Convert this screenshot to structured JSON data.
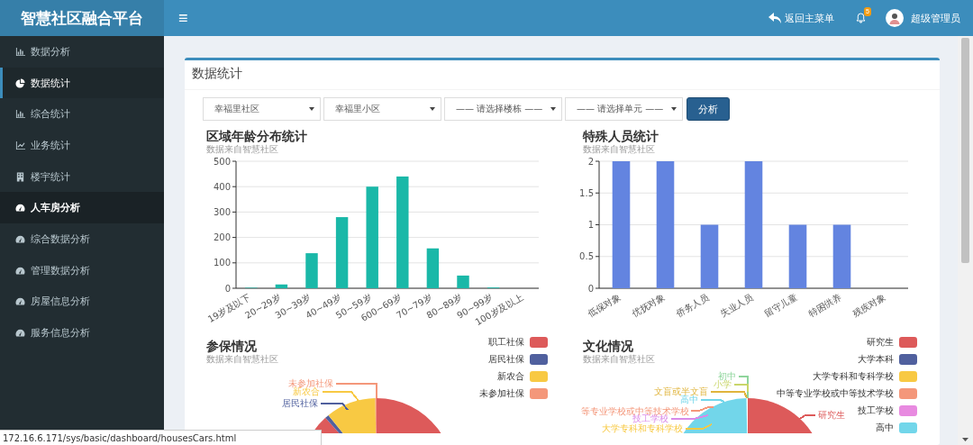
{
  "header": {
    "brand": "智慧社区融合平台",
    "menu_toggle": "≡",
    "back_link": "返回主菜单",
    "notification_count": "5",
    "user_name": "超级管理员"
  },
  "sidebar": {
    "items": [
      {
        "label": "数据分析",
        "selected": false,
        "highlighted": false
      },
      {
        "label": "数据统计",
        "selected": true,
        "highlighted": false
      },
      {
        "label": "综合统计",
        "selected": false,
        "highlighted": false
      },
      {
        "label": "业务统计",
        "selected": false,
        "highlighted": false
      },
      {
        "label": "楼宇统计",
        "selected": false,
        "highlighted": false
      },
      {
        "label": "人车房分析",
        "selected": false,
        "highlighted": true
      },
      {
        "label": "综合数据分析",
        "selected": false,
        "highlighted": false
      },
      {
        "label": "管理数据分析",
        "selected": false,
        "highlighted": false
      },
      {
        "label": "房屋信息分析",
        "selected": false,
        "highlighted": false
      },
      {
        "label": "服务信息分析",
        "selected": false,
        "highlighted": false
      }
    ]
  },
  "card": {
    "title": "数据统计",
    "filters": [
      {
        "value": "幸福里社区"
      },
      {
        "value": "幸福里小区"
      },
      {
        "value": "—— 请选择楼栋 ——"
      },
      {
        "value": "—— 请选择单元 ——"
      }
    ],
    "analyze_button": "分析",
    "bar_charts": [
      {
        "title": "区域年龄分布统计",
        "subtitle": "数据来自智慧社区",
        "chart_data": {
          "type": "bar",
          "categories": [
            "19岁及以下",
            "20~29岁",
            "30~39岁",
            "40~49岁",
            "50~59岁",
            "600~69岁",
            "70~79岁",
            "80~89岁",
            "90~99岁",
            "100岁及以上"
          ],
          "series": [
            {
              "color": "#1ab8a8",
              "values": [
                2,
                15,
                138,
                280,
                400,
                440,
                157,
                50,
                3,
                0
              ]
            }
          ],
          "grid": true,
          "ylim": [
            0,
            500
          ],
          "yticks": [
            0,
            100,
            200,
            300,
            400,
            500
          ]
        }
      },
      {
        "title": "特殊人员统计",
        "subtitle": "数据来自智慧社区",
        "chart_data": {
          "type": "bar",
          "categories": [
            "低保对象",
            "优抚对象",
            "侨务人员",
            "失业人员",
            "留守儿童",
            "特困供养",
            "残疾对象"
          ],
          "series": [
            {
              "color": "#6384e0",
              "values": [
                2,
                2,
                1,
                2,
                1,
                1,
                0
              ]
            }
          ],
          "grid": true,
          "ylim": [
            0,
            2
          ],
          "yticks": [
            0,
            0.5,
            1,
            1.5,
            2
          ]
        }
      }
    ],
    "pie_charts": [
      {
        "title": "参保情况",
        "subtitle": "数据来自智慧社区",
        "legend": [
          {
            "label": "职工社保",
            "color": "#dd5a5a"
          },
          {
            "label": "居民社保",
            "color": "#50609e"
          },
          {
            "label": "新农合",
            "color": "#f8c943"
          },
          {
            "label": "未参加社保",
            "color": "#f4977a"
          }
        ],
        "callouts": [
          {
            "text": "未参加社保",
            "color": "#f4977a"
          },
          {
            "text": "新农合",
            "color": "#f8c943"
          },
          {
            "text": "居民社保",
            "color": "#50609e"
          }
        ]
      },
      {
        "title": "文化情况",
        "subtitle": "数据来自智慧社区",
        "legend": [
          {
            "label": "研究生",
            "color": "#dd5a5a"
          },
          {
            "label": "大学本科",
            "color": "#50609e"
          },
          {
            "label": "大学专科和专科学校",
            "color": "#f8c943"
          },
          {
            "label": "中等专业学校或中等技术学校",
            "color": "#f4977a"
          },
          {
            "label": "技工学校",
            "color": "#e88ae0"
          },
          {
            "label": "高中",
            "color": "#72d6ea"
          }
        ],
        "callouts": [
          {
            "text": "初中",
            "color": "#8fd59c"
          },
          {
            "text": "小学",
            "color": "#c9d66a"
          },
          {
            "text": "文盲或半文盲",
            "color": "#e0b43c"
          },
          {
            "text": "高中",
            "color": "#72d6ea"
          },
          {
            "text": "等专业学校或中等技术学校",
            "color": "#f4977a"
          },
          {
            "text": "技工学校",
            "color": "#d98ae8"
          },
          {
            "text": "大学专科和专科学校",
            "color": "#f8c943"
          },
          {
            "text": "研究生",
            "color": "#dd5a5a"
          }
        ]
      }
    ]
  },
  "status_bar": "172.16.6.171/sys/basic/dashboard/housesCars.html"
}
